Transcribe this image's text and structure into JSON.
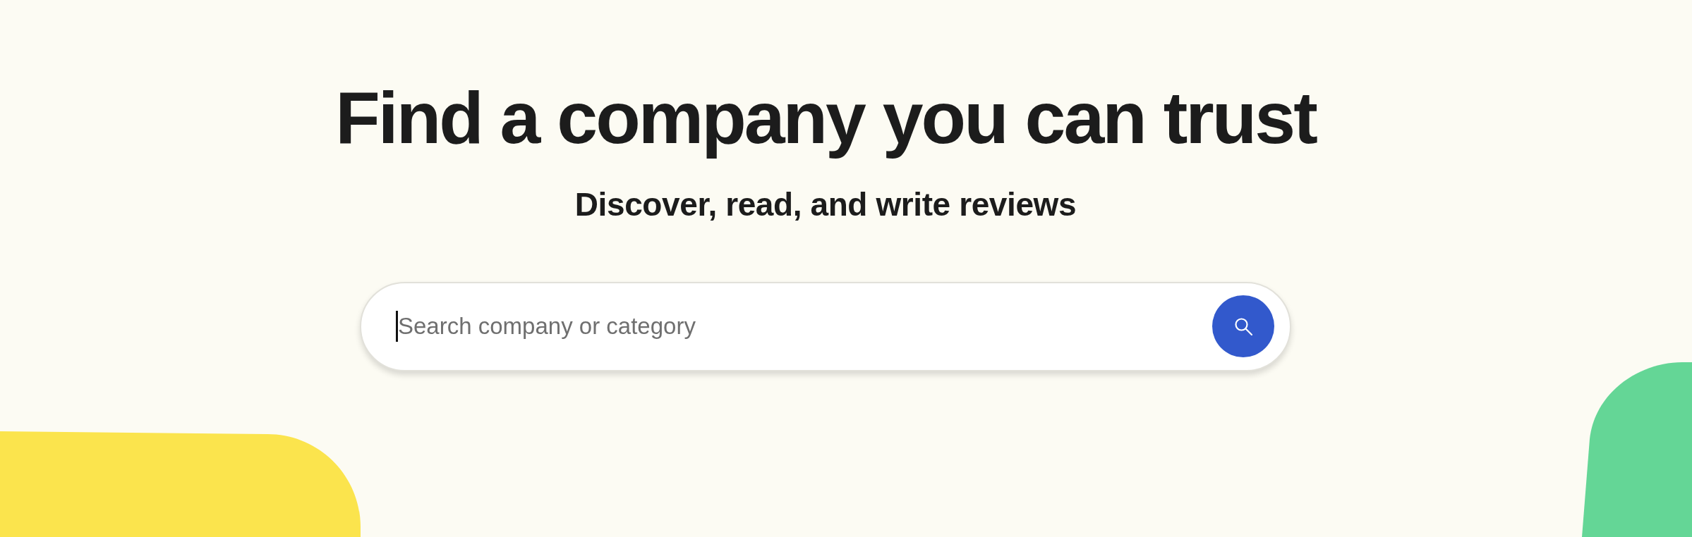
{
  "hero": {
    "title": "Find a company you can trust",
    "subtitle": "Discover, read, and write reviews"
  },
  "search": {
    "placeholder": "Search company or category",
    "focused": true
  }
}
